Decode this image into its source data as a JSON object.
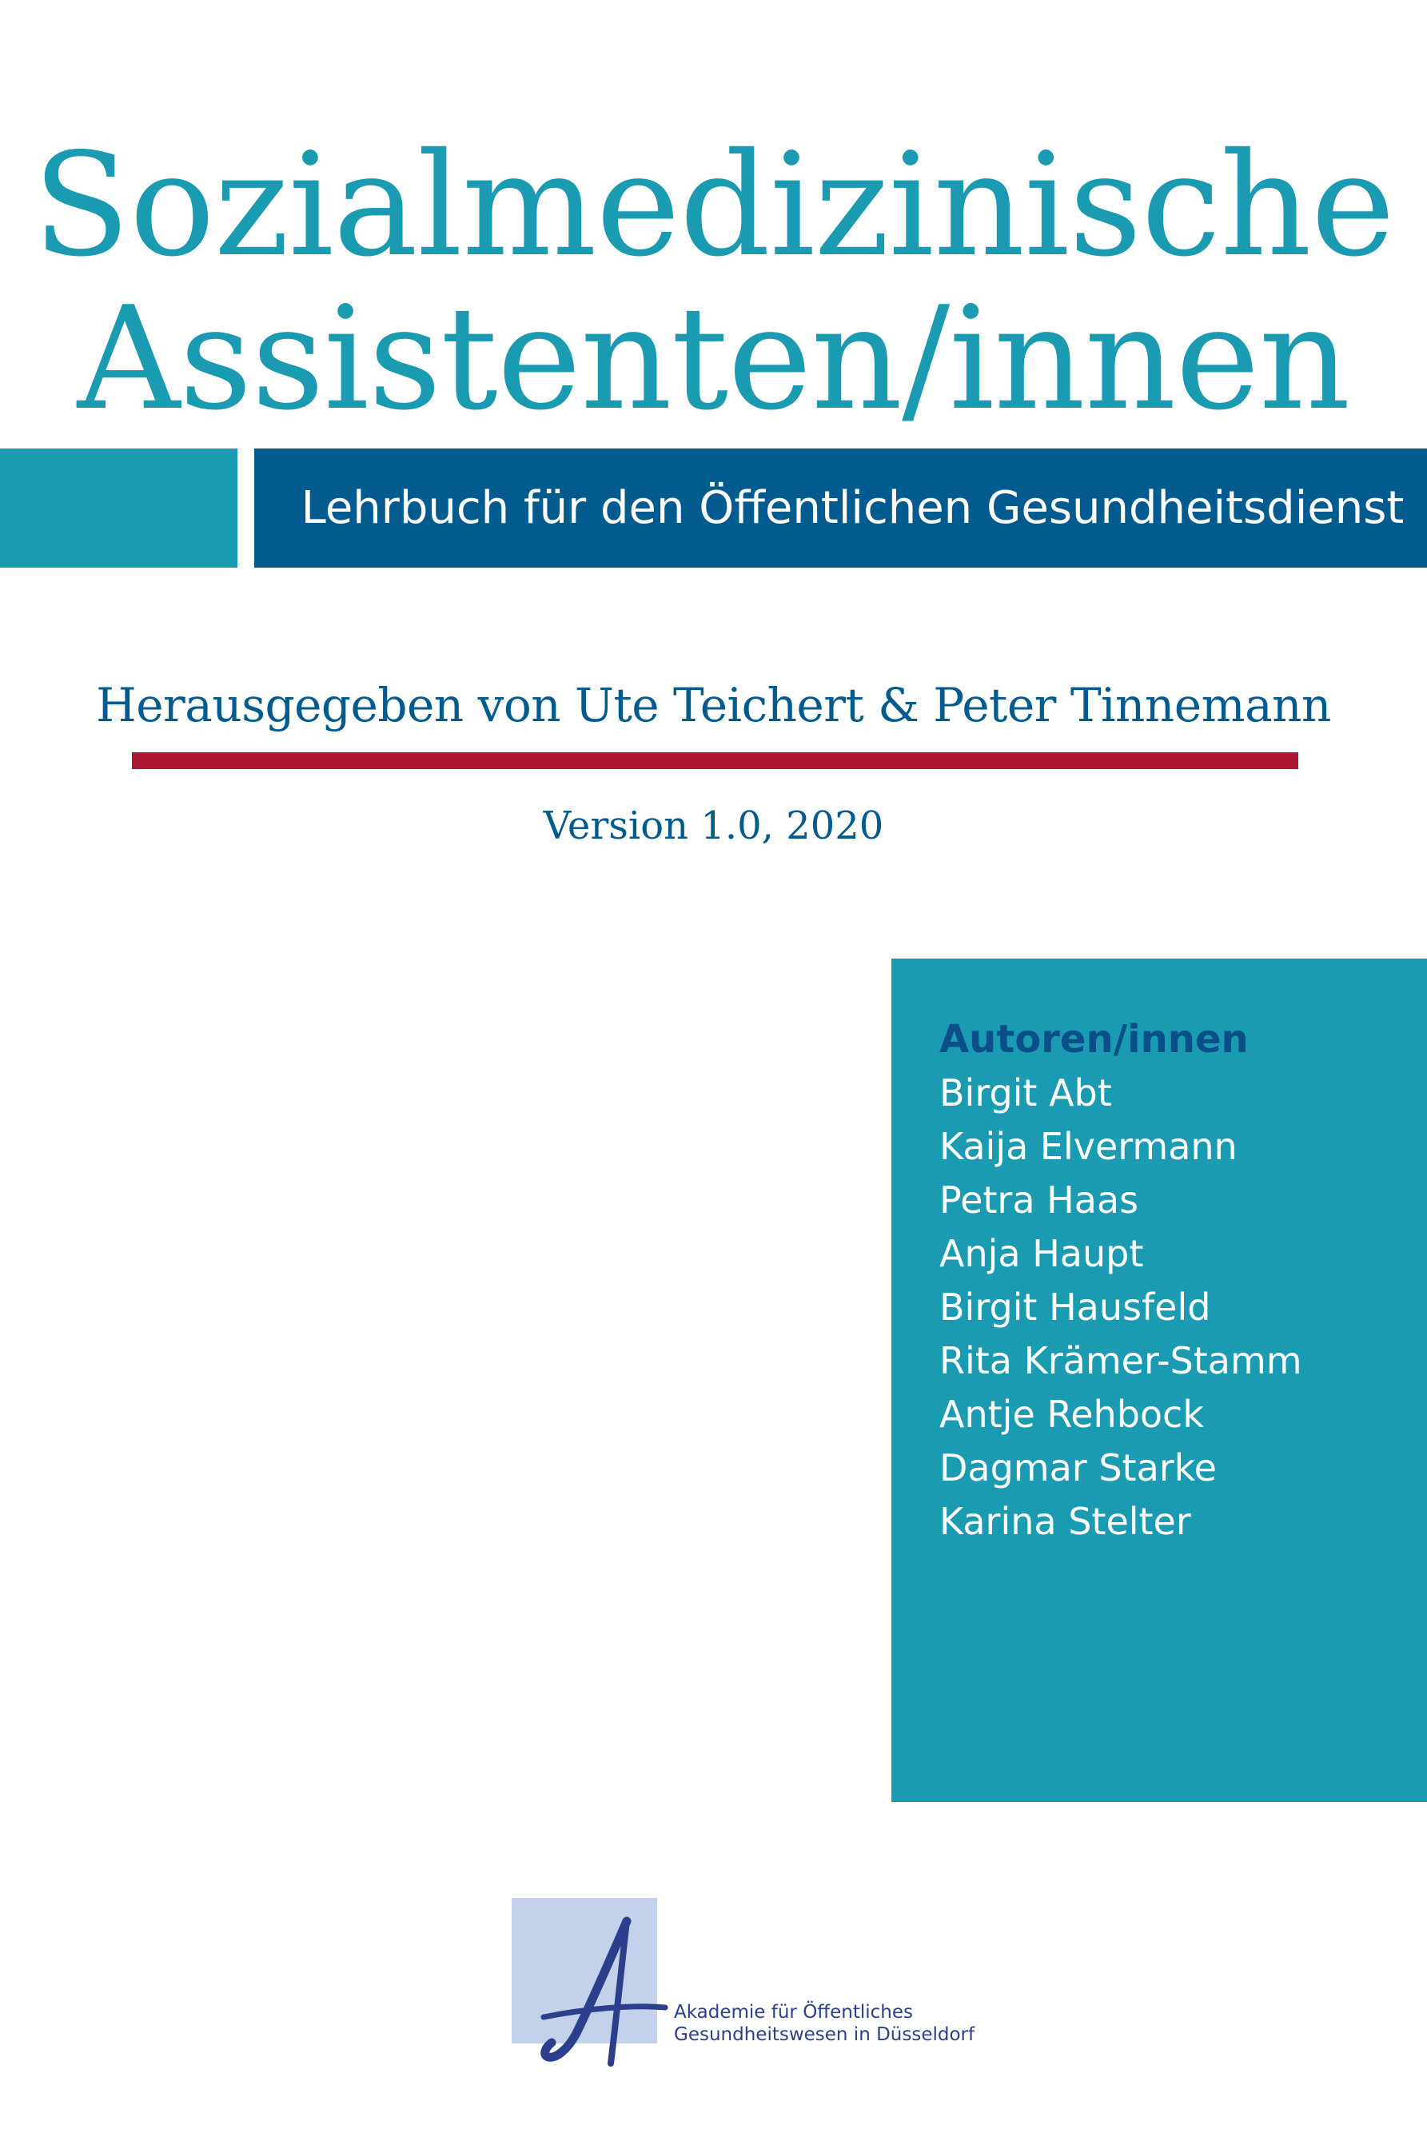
{
  "cover": {
    "title_line_1": "Sozialmedizinische",
    "title_line_2": "Assistenten/innen",
    "subtitle": "Lehrbuch für den Öffentlichen Gesundheitsdienst",
    "editors": "Herausgegeben von Ute Teichert & Peter Tinnemann",
    "version": "Version 1.0, 2020"
  },
  "authors": {
    "heading": "Autoren/innen",
    "names": [
      "Birgit Abt",
      "Kaija Elvermann",
      "Petra Haas",
      "Anja Haupt",
      "Birgit Hausfeld",
      "Rita Krämer-Stamm",
      "Antje Rehbock",
      "Dagmar Starke",
      "Karina Stelter"
    ]
  },
  "publisher": {
    "line_1": "Akademie für Öffentliches",
    "line_2": "Gesundheitswesen in Düsseldorf",
    "logo_icon": "akademie-a-logo"
  },
  "colors": {
    "title_teal": "#1a9bb2",
    "dark_blue": "#025b8e",
    "red_rule": "#ad1630",
    "logo_square": "#c3d1ea",
    "logo_blue": "#2b3f8c"
  }
}
